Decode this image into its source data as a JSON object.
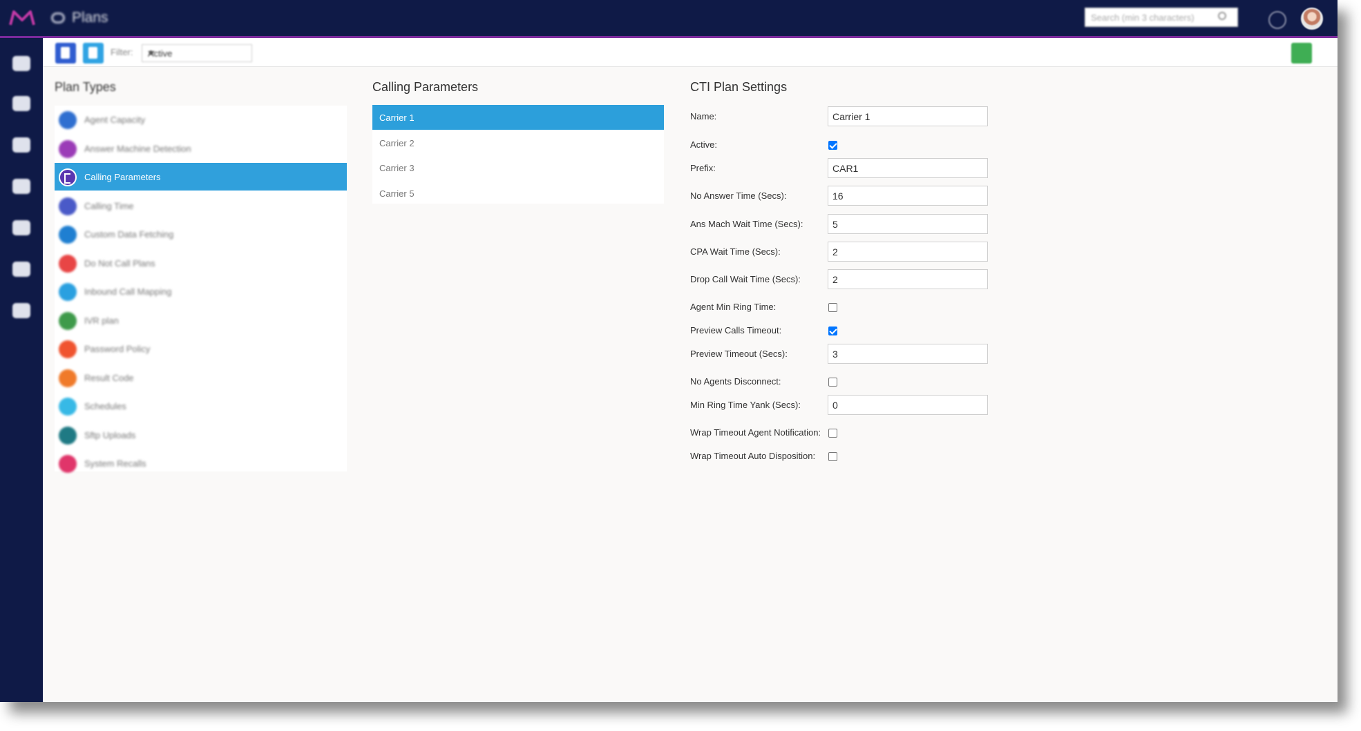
{
  "app": {
    "title": "Plans",
    "search_placeholder": "Search (min 3 characters)",
    "accent": "#7b2a9c",
    "nav_bg": "#0f1a47",
    "selected_color": "#30a0dc"
  },
  "toolbar": {
    "filter_label": "Filter:",
    "filter_value": "Active"
  },
  "plan_types": {
    "heading": "Plan Types",
    "items": [
      {
        "label": "Agent Capacity",
        "color": "#2f6fd0"
      },
      {
        "label": "Answer Machine Detection",
        "color": "#9b3cb7"
      },
      {
        "label": "Calling Parameters",
        "color": "#5a36b0"
      },
      {
        "label": "Calling Time",
        "color": "#4a5ac8"
      },
      {
        "label": "Custom Data Fetching",
        "color": "#1f7fd1"
      },
      {
        "label": "Do Not Call Plans",
        "color": "#e84545"
      },
      {
        "label": "Inbound Call Mapping",
        "color": "#2aa0e0"
      },
      {
        "label": "IVR plan",
        "color": "#3e9a4a"
      },
      {
        "label": "Password Policy",
        "color": "#f0542f"
      },
      {
        "label": "Result Code",
        "color": "#f07a2a"
      },
      {
        "label": "Schedules",
        "color": "#37b9e6"
      },
      {
        "label": "Sftp Uploads",
        "color": "#1f7a84"
      },
      {
        "label": "System Recalls",
        "color": "#e0356a"
      }
    ]
  },
  "calling_parameters": {
    "heading": "Calling Parameters",
    "items": [
      "Carrier 1",
      "Carrier 2",
      "Carrier 3",
      "Carrier 5"
    ]
  },
  "cti": {
    "heading": "CTI Plan Settings",
    "fields": [
      {
        "label": "Name:",
        "type": "text",
        "value": "Carrier 1"
      },
      {
        "label": "Active:",
        "type": "check",
        "checked": true
      },
      {
        "label": "Prefix:",
        "type": "text",
        "value": "CAR1"
      },
      {
        "label": "No Answer Time (Secs):",
        "type": "text",
        "value": "16"
      },
      {
        "label": "Ans Mach Wait Time (Secs):",
        "type": "text",
        "value": "5"
      },
      {
        "label": "CPA Wait Time (Secs):",
        "type": "text",
        "value": "2"
      },
      {
        "label": "Drop Call Wait Time (Secs):",
        "type": "text",
        "value": "2"
      },
      {
        "label": "Agent Min Ring Time:",
        "type": "check",
        "checked": false
      },
      {
        "label": "Preview Calls Timeout:",
        "type": "check",
        "checked": true
      },
      {
        "label": "Preview Timeout (Secs):",
        "type": "text",
        "value": "3"
      },
      {
        "label": "No Agents Disconnect:",
        "type": "check",
        "checked": false
      },
      {
        "label": "Min Ring Time Yank (Secs):",
        "type": "text",
        "value": "0"
      },
      {
        "label": "Wrap Timeout Agent Notification:",
        "type": "check",
        "checked": false
      },
      {
        "label": "Wrap Timeout Auto Disposition:",
        "type": "check",
        "checked": false
      }
    ]
  }
}
